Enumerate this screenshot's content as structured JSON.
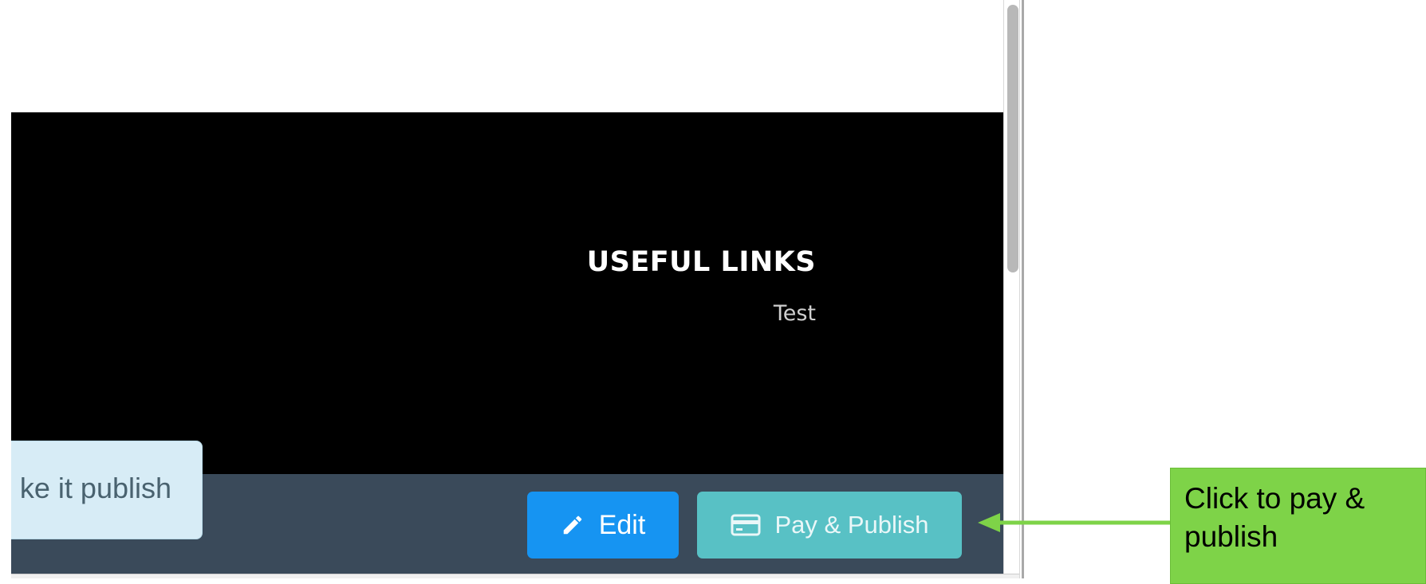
{
  "footer": {
    "heading": "USEFUL LINKS",
    "links": [
      {
        "label": "Test"
      }
    ]
  },
  "notice": {
    "text": "ke it publish"
  },
  "toolbar": {
    "edit_label": "Edit",
    "pay_publish_label": "Pay & Publish",
    "edit_icon": "pencil-icon",
    "pay_icon": "credit-card-icon"
  },
  "annotation": {
    "text": "Click to pay & publish"
  },
  "colors": {
    "edit_button": "#1694f2",
    "pay_button": "#58c1c5",
    "bottom_bar": "#3a4a5a",
    "callout": "#7ed348",
    "arrow": "#7ed348"
  }
}
